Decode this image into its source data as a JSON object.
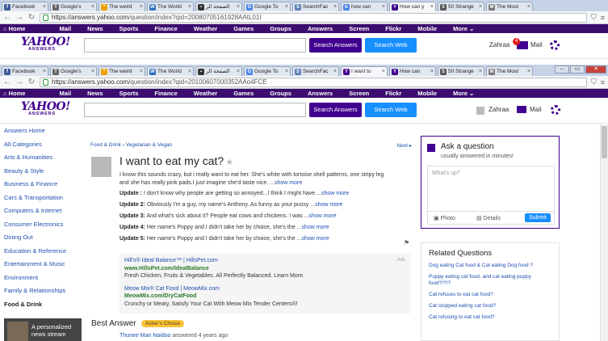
{
  "back_window": {
    "tabs": [
      {
        "label": "Facebook",
        "color": "#3b5998",
        "glyph": "f"
      },
      {
        "label": "Google's",
        "color": "#666666",
        "glyph": "T"
      },
      {
        "label": "The weird",
        "color": "#f0a000",
        "glyph": "*"
      },
      {
        "label": "The World",
        "color": "#2b6fbf",
        "glyph": "W"
      },
      {
        "label": "الصفحة الر",
        "color": "#333333",
        "glyph": "▪"
      },
      {
        "label": "Google To",
        "color": "#4a86e8",
        "glyph": "G"
      },
      {
        "label": "SearchFac",
        "color": "#5a7fb8",
        "glyph": "S"
      },
      {
        "label": "how can",
        "color": "#4a86e8",
        "glyph": "b"
      },
      {
        "label": "How can y",
        "color": "#400090",
        "glyph": "Y"
      },
      {
        "label": "50 Strange",
        "color": "#555555",
        "glyph": "5"
      },
      {
        "label": "The Most",
        "color": "#777777",
        "glyph": "M"
      }
    ],
    "url_host": "https://answers.yahoo.com",
    "url_path": "/question/index?qid=20080705161928AAtL01I",
    "nav": [
      "Home",
      "Mail",
      "News",
      "Sports",
      "Finance",
      "Weather",
      "Games",
      "Groups",
      "Answers",
      "Screen",
      "Flickr",
      "Mobile",
      "More ⌄"
    ],
    "user": "Zahraa",
    "mail_label": "Mail",
    "mail_count": "4"
  },
  "window": {
    "tabs": [
      {
        "label": "Facebook",
        "color": "#3b5998",
        "glyph": "f"
      },
      {
        "label": "Google's",
        "color": "#666666",
        "glyph": "T"
      },
      {
        "label": "The weird",
        "color": "#f0a000",
        "glyph": "*"
      },
      {
        "label": "The World",
        "color": "#2b6fbf",
        "glyph": "W"
      },
      {
        "label": "الصفحة الر",
        "color": "#333333",
        "glyph": "▪"
      },
      {
        "label": "Google To",
        "color": "#4a86e8",
        "glyph": "G"
      },
      {
        "label": "SearchFac",
        "color": "#5a7fb8",
        "glyph": "S"
      },
      {
        "label": "I want to",
        "color": "#400090",
        "glyph": "Y"
      },
      {
        "label": "How can",
        "color": "#400090",
        "glyph": "Y"
      },
      {
        "label": "50 Strange",
        "color": "#555555",
        "glyph": "5"
      },
      {
        "label": "The Most",
        "color": "#777777",
        "glyph": "M"
      }
    ],
    "url_host": "https://answers.yahoo.com",
    "url_path": "/question/index?qid=20100607000352AAo4FCE",
    "nav": [
      "Home",
      "Mail",
      "News",
      "Sports",
      "Finance",
      "Weather",
      "Games",
      "Groups",
      "Answers",
      "Screen",
      "Flickr",
      "Mobile",
      "More ⌄"
    ]
  },
  "header": {
    "logo_main": "YAHOO!",
    "logo_sub": "ANSWERS",
    "search_answers": "Search Answers",
    "search_web": "Search Web",
    "user": "Zahraa",
    "mail_label": "Mail"
  },
  "sidebar": [
    "Answers Home",
    "All Categories",
    "Arts & Humanities",
    "Beauty & Style",
    "Business & Finance",
    "Cars & Transportation",
    "Computers & Internet",
    "Consumer Electronics",
    "Dining Out",
    "Education & Reference",
    "Entertainment & Music",
    "Environment",
    "Family & Relationships",
    "Food & Drink"
  ],
  "sidebar_ad": "A personalized news stream",
  "question": {
    "breadcrumb": "Food & Drink › Vegetarian & Vegan",
    "next": "Next ▸",
    "title": "I want to eat my cat?",
    "body_1": "I know this sounds crazy, but i really want to eat her. She's white with tortoise shell patterns, one stripy leg",
    "body_2": "and she has really pink pads.I just imagine she'd taste nice. ...",
    "show_more": "show more",
    "updates": [
      {
        "label": "Update :",
        "text": " I don't know why people are getting so annoyed...I think I might have ..."
      },
      {
        "label": "Update 2:",
        "text": " Obviously I'm a guy, my name's Anthony. As funny as your pussy ..."
      },
      {
        "label": "Update 3:",
        "text": " And what's sick about it? People eat cows and chickens. I was ..."
      },
      {
        "label": "Update 4:",
        "text": " Her name's Poppy and I didn't take her by choice, she's the ..."
      },
      {
        "label": "Update 5:",
        "text": " Her name's Poppy and I didn't take her by choice, she's the ..."
      }
    ]
  },
  "ads": {
    "label": "Ads",
    "ad1_title": "Hill's® Ideal Balance™ | HillsPet.com",
    "ad1_url": "www.HillsPet.com/IdealBalance",
    "ad1_text": "Fresh Chicken, Fruits & Vegetables. All Perfectly Balanced. Learn More.",
    "ad2_title": "Meow Mix® Cat Food | MeowMix.com",
    "ad2_url": "MeowMix.com/DryCatFood",
    "ad2_text": "Crunchy or Meaty, Satisfy Your Cat With Meow Mix Tender Centers®!"
  },
  "best_answer": {
    "heading": "Best Answer",
    "badge": "Asker's Choice",
    "author": "Thunee Man Naidoo",
    "when": " answered 4 years ago"
  },
  "ask": {
    "title": "Ask a question",
    "subtitle": "usually answered in minutes!",
    "placeholder": "What's up?",
    "photo": "Photo",
    "details": "Details",
    "submit": "Submit"
  },
  "related": {
    "heading": "Related Questions",
    "items": [
      "Dog eating Cat food & Cat eating Dog food ?",
      "Puppy eating cat food, and cat eating puppy food?!?!?",
      "Cat refuses to eat cat food?",
      "Cat stopped eating cat food?",
      "Cat refusing to eat cat food?"
    ]
  }
}
